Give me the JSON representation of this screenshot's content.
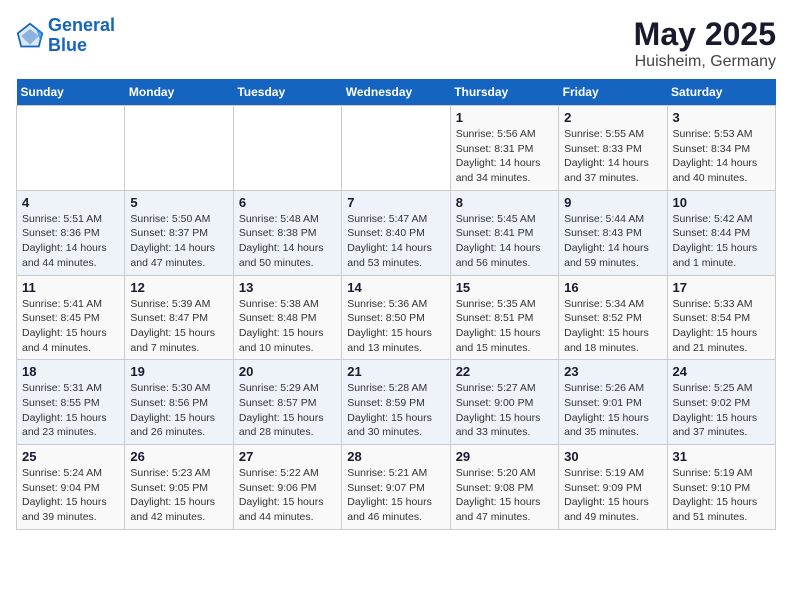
{
  "header": {
    "logo_line1": "General",
    "logo_line2": "Blue",
    "month": "May 2025",
    "location": "Huisheim, Germany"
  },
  "weekdays": [
    "Sunday",
    "Monday",
    "Tuesday",
    "Wednesday",
    "Thursday",
    "Friday",
    "Saturday"
  ],
  "weeks": [
    [
      {
        "day": "",
        "info": ""
      },
      {
        "day": "",
        "info": ""
      },
      {
        "day": "",
        "info": ""
      },
      {
        "day": "",
        "info": ""
      },
      {
        "day": "1",
        "info": "Sunrise: 5:56 AM\nSunset: 8:31 PM\nDaylight: 14 hours\nand 34 minutes."
      },
      {
        "day": "2",
        "info": "Sunrise: 5:55 AM\nSunset: 8:33 PM\nDaylight: 14 hours\nand 37 minutes."
      },
      {
        "day": "3",
        "info": "Sunrise: 5:53 AM\nSunset: 8:34 PM\nDaylight: 14 hours\nand 40 minutes."
      }
    ],
    [
      {
        "day": "4",
        "info": "Sunrise: 5:51 AM\nSunset: 8:36 PM\nDaylight: 14 hours\nand 44 minutes."
      },
      {
        "day": "5",
        "info": "Sunrise: 5:50 AM\nSunset: 8:37 PM\nDaylight: 14 hours\nand 47 minutes."
      },
      {
        "day": "6",
        "info": "Sunrise: 5:48 AM\nSunset: 8:38 PM\nDaylight: 14 hours\nand 50 minutes."
      },
      {
        "day": "7",
        "info": "Sunrise: 5:47 AM\nSunset: 8:40 PM\nDaylight: 14 hours\nand 53 minutes."
      },
      {
        "day": "8",
        "info": "Sunrise: 5:45 AM\nSunset: 8:41 PM\nDaylight: 14 hours\nand 56 minutes."
      },
      {
        "day": "9",
        "info": "Sunrise: 5:44 AM\nSunset: 8:43 PM\nDaylight: 14 hours\nand 59 minutes."
      },
      {
        "day": "10",
        "info": "Sunrise: 5:42 AM\nSunset: 8:44 PM\nDaylight: 15 hours\nand 1 minute."
      }
    ],
    [
      {
        "day": "11",
        "info": "Sunrise: 5:41 AM\nSunset: 8:45 PM\nDaylight: 15 hours\nand 4 minutes."
      },
      {
        "day": "12",
        "info": "Sunrise: 5:39 AM\nSunset: 8:47 PM\nDaylight: 15 hours\nand 7 minutes."
      },
      {
        "day": "13",
        "info": "Sunrise: 5:38 AM\nSunset: 8:48 PM\nDaylight: 15 hours\nand 10 minutes."
      },
      {
        "day": "14",
        "info": "Sunrise: 5:36 AM\nSunset: 8:50 PM\nDaylight: 15 hours\nand 13 minutes."
      },
      {
        "day": "15",
        "info": "Sunrise: 5:35 AM\nSunset: 8:51 PM\nDaylight: 15 hours\nand 15 minutes."
      },
      {
        "day": "16",
        "info": "Sunrise: 5:34 AM\nSunset: 8:52 PM\nDaylight: 15 hours\nand 18 minutes."
      },
      {
        "day": "17",
        "info": "Sunrise: 5:33 AM\nSunset: 8:54 PM\nDaylight: 15 hours\nand 21 minutes."
      }
    ],
    [
      {
        "day": "18",
        "info": "Sunrise: 5:31 AM\nSunset: 8:55 PM\nDaylight: 15 hours\nand 23 minutes."
      },
      {
        "day": "19",
        "info": "Sunrise: 5:30 AM\nSunset: 8:56 PM\nDaylight: 15 hours\nand 26 minutes."
      },
      {
        "day": "20",
        "info": "Sunrise: 5:29 AM\nSunset: 8:57 PM\nDaylight: 15 hours\nand 28 minutes."
      },
      {
        "day": "21",
        "info": "Sunrise: 5:28 AM\nSunset: 8:59 PM\nDaylight: 15 hours\nand 30 minutes."
      },
      {
        "day": "22",
        "info": "Sunrise: 5:27 AM\nSunset: 9:00 PM\nDaylight: 15 hours\nand 33 minutes."
      },
      {
        "day": "23",
        "info": "Sunrise: 5:26 AM\nSunset: 9:01 PM\nDaylight: 15 hours\nand 35 minutes."
      },
      {
        "day": "24",
        "info": "Sunrise: 5:25 AM\nSunset: 9:02 PM\nDaylight: 15 hours\nand 37 minutes."
      }
    ],
    [
      {
        "day": "25",
        "info": "Sunrise: 5:24 AM\nSunset: 9:04 PM\nDaylight: 15 hours\nand 39 minutes."
      },
      {
        "day": "26",
        "info": "Sunrise: 5:23 AM\nSunset: 9:05 PM\nDaylight: 15 hours\nand 42 minutes."
      },
      {
        "day": "27",
        "info": "Sunrise: 5:22 AM\nSunset: 9:06 PM\nDaylight: 15 hours\nand 44 minutes."
      },
      {
        "day": "28",
        "info": "Sunrise: 5:21 AM\nSunset: 9:07 PM\nDaylight: 15 hours\nand 46 minutes."
      },
      {
        "day": "29",
        "info": "Sunrise: 5:20 AM\nSunset: 9:08 PM\nDaylight: 15 hours\nand 47 minutes."
      },
      {
        "day": "30",
        "info": "Sunrise: 5:19 AM\nSunset: 9:09 PM\nDaylight: 15 hours\nand 49 minutes."
      },
      {
        "day": "31",
        "info": "Sunrise: 5:19 AM\nSunset: 9:10 PM\nDaylight: 15 hours\nand 51 minutes."
      }
    ]
  ]
}
